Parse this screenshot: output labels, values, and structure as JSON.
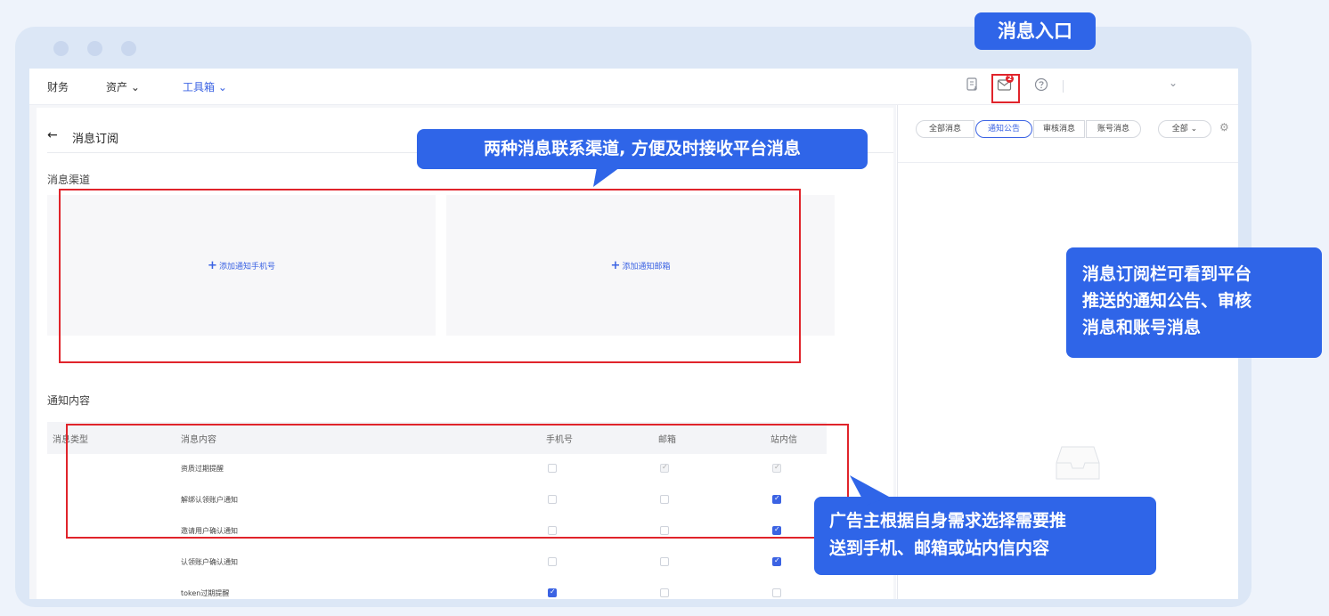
{
  "nav": {
    "items": [
      {
        "label": "财务"
      },
      {
        "label": "资产 ⌄"
      },
      {
        "label": "工具箱 ⌄"
      }
    ],
    "icons": [
      "invoice-icon",
      "mail-icon",
      "help-icon",
      "chevron-down-icon"
    ],
    "badge": "2"
  },
  "page": {
    "back_icon": "←",
    "title": "消息订阅",
    "channel_section": "消息渠道",
    "add_phone": "添加通知手机号",
    "add_email": "添加通知邮箱",
    "content_section": "通知内容"
  },
  "table": {
    "headers": [
      "消息类型",
      "消息内容",
      "手机号",
      "邮箱",
      "站内信"
    ],
    "rows": [
      {
        "content": "资质过期提醒",
        "phone": "unchecked",
        "email": "dim-checked",
        "site": "dim-checked"
      },
      {
        "content": "解绑认领账户通知",
        "phone": "unchecked",
        "email": "unchecked",
        "site": "checked"
      },
      {
        "content": "邀请用户确认通知",
        "phone": "unchecked",
        "email": "unchecked",
        "site": "checked"
      },
      {
        "content": "认领账户确认通知",
        "phone": "unchecked",
        "email": "unchecked",
        "site": "checked"
      },
      {
        "content": "token过期提醒",
        "phone": "checked",
        "email": "unchecked",
        "site": "unchecked"
      }
    ]
  },
  "right_panel": {
    "tabs": [
      "全部消息",
      "通知公告",
      "审核消息",
      "账号消息"
    ],
    "active_tab": "通知公告",
    "filter": "全部 ⌄",
    "settings_icon": "gear-icon"
  },
  "callouts": {
    "entry": "消息入口",
    "channels": "两种消息联系渠道, 方便及时接收平台消息",
    "panel_lines": [
      "消息订阅栏可看到平台",
      "推送的通知公告、审核",
      "消息和账号消息"
    ],
    "content_lines": [
      "广告主根据自身需求选择需要推",
      "送到手机、邮箱或站内信内容"
    ]
  },
  "colors": {
    "accent": "#3b63e3",
    "callout": "#2f65e8",
    "highlight": "#e0242b"
  }
}
